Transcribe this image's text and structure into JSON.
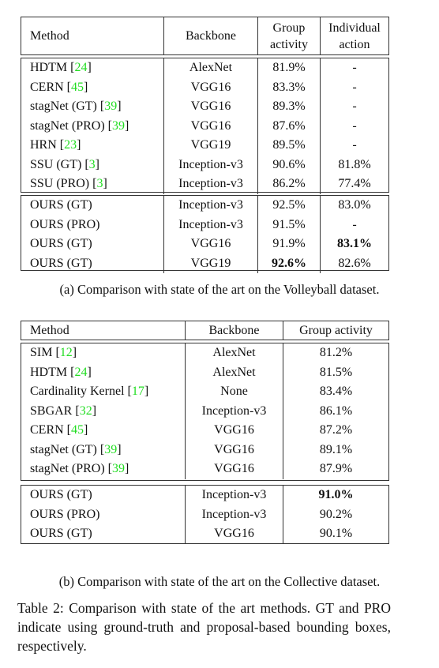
{
  "table_a": {
    "headers": {
      "method": "Method",
      "backbone": "Backbone",
      "group_line1": "Group",
      "group_line2": "activity",
      "indiv_line1": "Individual",
      "indiv_line2": "action"
    },
    "prior_rows": [
      {
        "method": "HDTM [",
        "cite": "24",
        "close": "]",
        "backbone": "AlexNet",
        "group": "81.9%",
        "individual": "-"
      },
      {
        "method": "CERN [",
        "cite": "45",
        "close": "]",
        "backbone": "VGG16",
        "group": "83.3%",
        "individual": "-"
      },
      {
        "method": "stagNet (GT) [",
        "cite": "39",
        "close": "]",
        "backbone": "VGG16",
        "group": "89.3%",
        "individual": "-"
      },
      {
        "method": "stagNet (PRO) [",
        "cite": "39",
        "close": "]",
        "backbone": "VGG16",
        "group": "87.6%",
        "individual": "-"
      },
      {
        "method": "HRN [",
        "cite": "23",
        "close": "]",
        "backbone": "VGG19",
        "group": "89.5%",
        "individual": "-"
      },
      {
        "method": "SSU (GT) [",
        "cite": "3",
        "close": "]",
        "backbone": "Inception-v3",
        "group": "90.6%",
        "individual": "81.8%"
      },
      {
        "method": "SSU (PRO) [",
        "cite": "3",
        "close": "]",
        "backbone": "Inception-v3",
        "group": "86.2%",
        "individual": "77.4%"
      }
    ],
    "ours_rows": [
      {
        "method": "OURS (GT)",
        "backbone": "Inception-v3",
        "group": "92.5%",
        "individual": "83.0%"
      },
      {
        "method": "OURS (PRO)",
        "backbone": "Inception-v3",
        "group": "91.5%",
        "individual": "-"
      },
      {
        "method": "OURS (GT)",
        "backbone": "VGG16",
        "group": "91.9%",
        "individual": "83.1%"
      },
      {
        "method": "OURS (GT)",
        "backbone": "VGG19",
        "group": "92.6%",
        "individual": "82.6%"
      }
    ],
    "caption": "(a) Comparison with state of the art on the Volleyball dataset."
  },
  "table_b": {
    "headers": {
      "method": "Method",
      "backbone": "Backbone",
      "group": "Group activity"
    },
    "prior_rows": [
      {
        "method": "SIM [",
        "cite": "12",
        "close": "]",
        "backbone": "AlexNet",
        "group": "81.2%"
      },
      {
        "method": "HDTM [",
        "cite": "24",
        "close": "]",
        "backbone": "AlexNet",
        "group": "81.5%"
      },
      {
        "method": "Cardinality Kernel [",
        "cite": "17",
        "close": "]",
        "backbone": "None",
        "group": "83.4%"
      },
      {
        "method": "SBGAR [",
        "cite": "32",
        "close": "]",
        "backbone": "Inception-v3",
        "group": "86.1%"
      },
      {
        "method": "CERN [",
        "cite": "45",
        "close": "]",
        "backbone": "VGG16",
        "group": "87.2%"
      },
      {
        "method": "stagNet (GT) [",
        "cite": "39",
        "close": "]",
        "backbone": "VGG16",
        "group": "89.1%"
      },
      {
        "method": "stagNet (PRO) [",
        "cite": "39",
        "close": "]",
        "backbone": "VGG16",
        "group": "87.9%"
      }
    ],
    "ours_rows": [
      {
        "method": "OURS (GT)",
        "backbone": "Inception-v3",
        "group": "91.0%"
      },
      {
        "method": "OURS (PRO)",
        "backbone": "Inception-v3",
        "group": "90.2%"
      },
      {
        "method": "OURS (GT)",
        "backbone": "VGG16",
        "group": "90.1%"
      }
    ],
    "caption": "(b) Comparison with state of the art on the Collective dataset."
  },
  "main_caption": "Table 2: Comparison with state of the art methods. GT and PRO indicate using ground-truth and proposal-based bounding boxes, respectively."
}
